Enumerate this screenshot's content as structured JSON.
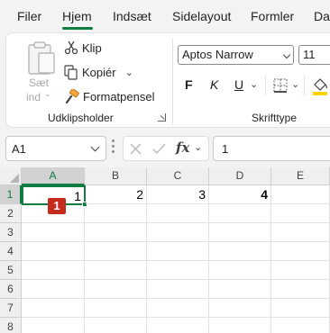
{
  "tabs": [
    "Filer",
    "Hjem",
    "Indsæt",
    "Sidelayout",
    "Formler",
    "Da"
  ],
  "active_tab": "Hjem",
  "clipboard": {
    "paste_label": "Sæt",
    "paste_sub": "ind",
    "cut": "Klip",
    "copy": "Kopiér",
    "format_painter": "Formatpensel",
    "group_label": "Udklipsholder"
  },
  "font": {
    "name": "Aptos Narrow",
    "size": "11",
    "bold": "F",
    "italic": "K",
    "underline": "U",
    "group_label": "Skrifttype"
  },
  "formula_bar": {
    "name_box": "A1",
    "fx": "fx",
    "value": "1"
  },
  "columns": [
    "A",
    "B",
    "C",
    "D",
    "E"
  ],
  "rows": [
    "1",
    "2",
    "3",
    "4",
    "5",
    "6",
    "7",
    "8"
  ],
  "cells": {
    "A1": "1",
    "B1": "2",
    "C1": "3",
    "D1": "4"
  },
  "badge": "1",
  "colors": {
    "accent": "#107c41",
    "badge": "#c42b1c"
  }
}
